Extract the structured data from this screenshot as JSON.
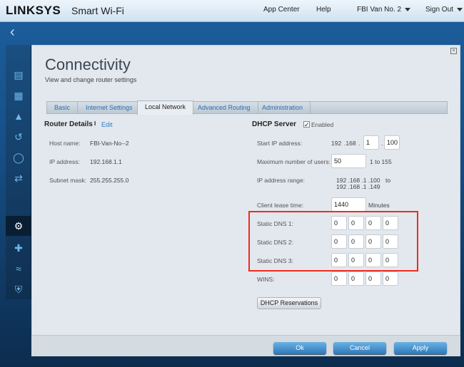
{
  "header": {
    "logo": "LINKSYS",
    "product": "Smart Wi-Fi",
    "app_center": "App Center",
    "help": "Help",
    "router": "FBI Van No. 2",
    "sign_out": "Sign Out"
  },
  "sidebar": {
    "icons": [
      "devices-icon",
      "parental-controls-icon",
      "security-alert-icon",
      "media-prioritization-icon",
      "speed-test-icon",
      "usb-storage-icon",
      "connectivity-gear-icon",
      "troubleshooting-icon",
      "wireless-icon",
      "security-shield-icon"
    ]
  },
  "modal": {
    "title": "Connectivity",
    "subtitle": "View and change router settings",
    "tabs": [
      "Basic",
      "Internet Settings",
      "Local Network",
      "Advanced Routing",
      "Administration"
    ],
    "active_tab": "Local Network"
  },
  "router_details": {
    "heading": "Router Details",
    "separator": "I",
    "edit": "Edit",
    "host_label": "Host name:",
    "host": "FBI-Van-No--2",
    "ip_label": "IP address:",
    "ip": "192.168.1.1",
    "mask_label": "Subnet mask:",
    "mask": "255.255.255.0"
  },
  "dhcp": {
    "heading": "DHCP Server",
    "enabled_label": "Enabled",
    "enabled": true,
    "start_ip_label": "Start IP address:",
    "start_ip_fixed1": "192",
    "start_ip_fixed2": ".168",
    "dot": ".",
    "start_ip_3": "1",
    "start_ip_4": "100",
    "max_users_label": "Maximum number of users:",
    "max_users": "50",
    "max_users_range": "1 to 155",
    "range_label": "IP address range:",
    "range_from": "192 .168 .1 .100",
    "range_to_word": "to",
    "range_to": "192 .168 .1 .149",
    "lease_label": "Client lease time:",
    "lease": "1440",
    "lease_unit": "Minutes",
    "dns1_label": "Static DNS 1:",
    "dns1": [
      "0",
      "0",
      "0",
      "0"
    ],
    "dns2_label": "Static DNS 2:",
    "dns2": [
      "0",
      "0",
      "0",
      "0"
    ],
    "dns3_label": "Static DNS 3:",
    "dns3": [
      "0",
      "0",
      "0",
      "0"
    ],
    "wins_label": "WINS:",
    "wins": [
      "0",
      "0",
      "0",
      "0"
    ],
    "reservations": "DHCP Reservations"
  },
  "footer": {
    "ok": "Ok",
    "cancel": "Cancel",
    "apply": "Apply"
  },
  "highlight_color": "#ee2b1f"
}
